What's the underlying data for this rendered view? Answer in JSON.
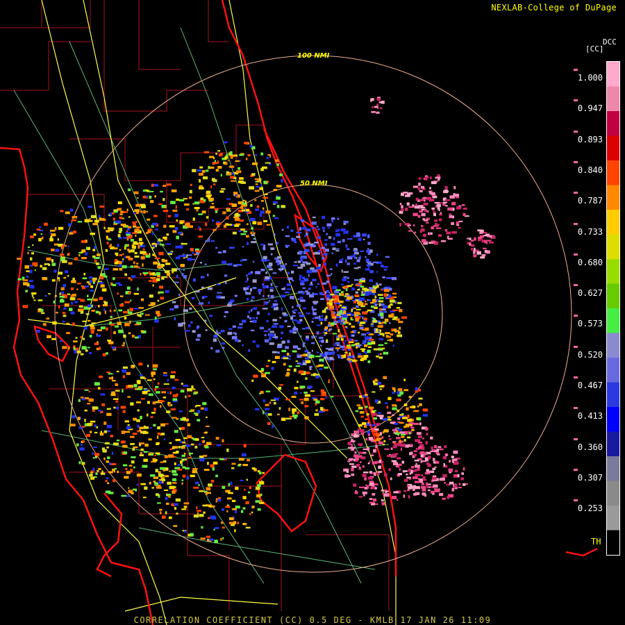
{
  "credit": "NEXLAB-College of DuPage",
  "footer": "CORRELATION COEFFICIENT (CC) 0.5 DEG - KMLB 17 JAN 26 11:09",
  "rings": [
    {
      "label": "100 NMI",
      "nmi": 100
    },
    {
      "label": "50 NMI",
      "nmi": 50
    }
  ],
  "legend": {
    "product": "DCC",
    "unit": "[CC]",
    "ticks": [
      "1.000",
      "0.947",
      "0.893",
      "0.840",
      "0.787",
      "0.733",
      "0.680",
      "0.627",
      "0.573",
      "0.520",
      "0.467",
      "0.413",
      "0.360",
      "0.307",
      "0.253"
    ],
    "th_label": "TH",
    "colors": [
      "#000000",
      "#9a9a9a",
      "#8a8a8a",
      "#7a7a9a",
      "#1a1aa0",
      "#0000ff",
      "#2a3ae0",
      "#6a6ae0",
      "#8a8ad0",
      "#44ee44",
      "#66cc00",
      "#99dd00",
      "#dddd00",
      "#ffcc00",
      "#ff8800",
      "#ff4400",
      "#dd0000",
      "#c00040",
      "#ee88aa",
      "#ffaacc"
    ]
  },
  "colors": {
    "coast": "#ff1111",
    "county": "#aa1122",
    "highway": "#ffff44",
    "road": "#66cc88",
    "ring": "#f0b090",
    "text": "#ffff00"
  }
}
